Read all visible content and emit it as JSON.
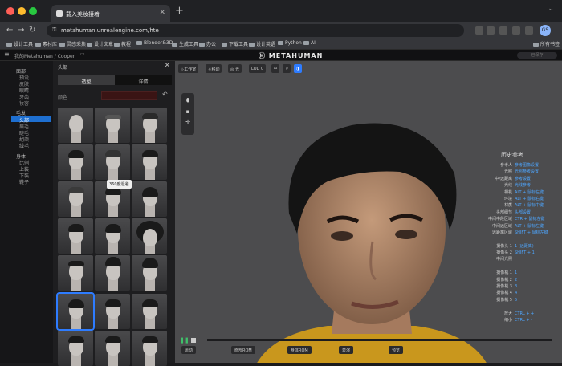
{
  "browser": {
    "tab_title": "载入美妆接着",
    "url": "metahuman.unrealengine.com/hte",
    "profile_initials": "GS",
    "bookmarks": [
      "设计工具",
      "素材库",
      "灵感采集",
      "设计文章",
      "教程",
      "Blender&3D",
      "生成工具",
      "办公",
      "下载工具",
      "设计英语",
      "Python",
      "AI"
    ],
    "bookmarks_right": "所有书签"
  },
  "app": {
    "breadcrumb": "我的Metahuman / Cooper",
    "logo_text": "METAHUMAN",
    "header_button": "已保存"
  },
  "left_nav": {
    "groups": [
      {
        "title": "面部",
        "items": [
          "预设",
          "皮肤",
          "眼睛",
          "牙齿",
          "妆容"
        ]
      },
      {
        "title": "毛发",
        "items": [
          "头部",
          "眉毛",
          "睫毛",
          "胡须",
          "绒毛"
        ]
      },
      {
        "title": "身体",
        "items": [
          "比例",
          "上装",
          "下装",
          "鞋子"
        ]
      }
    ],
    "selected": "头部"
  },
  "panel": {
    "title": "头部",
    "tabs": [
      "造型",
      "详情"
    ],
    "active_tab": "造型",
    "color_label": "颜色",
    "tooltip": "360度退避"
  },
  "viewport": {
    "toolbar": [
      "⊹工作室",
      "☀移动",
      "◎ 光",
      "LOD 0",
      "⚯",
      "⚐",
      "◑"
    ],
    "reference": {
      "title": "历史参考",
      "rows": [
        {
          "k": "参考人",
          "v": "参考图像设置"
        },
        {
          "k": "光照",
          "v": "光照参考设置"
        },
        {
          "k": "中/远距离",
          "v": "参考设置"
        },
        {
          "k": "光线",
          "v": "光线参考"
        },
        {
          "k": "相机",
          "v": "ALT + 鼠标左键"
        },
        {
          "k": "环境",
          "v": "ALT + 鼠标右键"
        },
        {
          "k": "材质",
          "v": "ALT + 鼠标中键"
        },
        {
          "k": "头部细节",
          "v": "头部设置"
        },
        {
          "k": "中间中段区域",
          "v": "CTR + 鼠标左键"
        },
        {
          "k": "中间远区域",
          "v": "ALT + 鼠标左键"
        },
        {
          "k": "远距离区域",
          "v": "SHIFT + 鼠标左键"
        },
        {
          "k": "",
          "v": ""
        },
        {
          "k": "摄像头 1",
          "v": "1 (远距离)"
        },
        {
          "k": "摄像头 2",
          "v": "SHIFT + 1"
        },
        {
          "k": "中间光照",
          "v": ""
        },
        {
          "k": "",
          "v": ""
        },
        {
          "k": "摄像机 1",
          "v": "1"
        },
        {
          "k": "摄像机 2",
          "v": "2"
        },
        {
          "k": "摄像机 3",
          "v": "3"
        },
        {
          "k": "摄像机 4",
          "v": "4"
        },
        {
          "k": "摄像机 5",
          "v": "5"
        },
        {
          "k": "",
          "v": ""
        },
        {
          "k": "放大",
          "v": "CTRL + +"
        },
        {
          "k": "缩小",
          "v": "CTRL + -"
        }
      ]
    },
    "bottom_pills": [
      "运动",
      "面部ROM",
      "身体ROM",
      "表演",
      "预览"
    ]
  }
}
